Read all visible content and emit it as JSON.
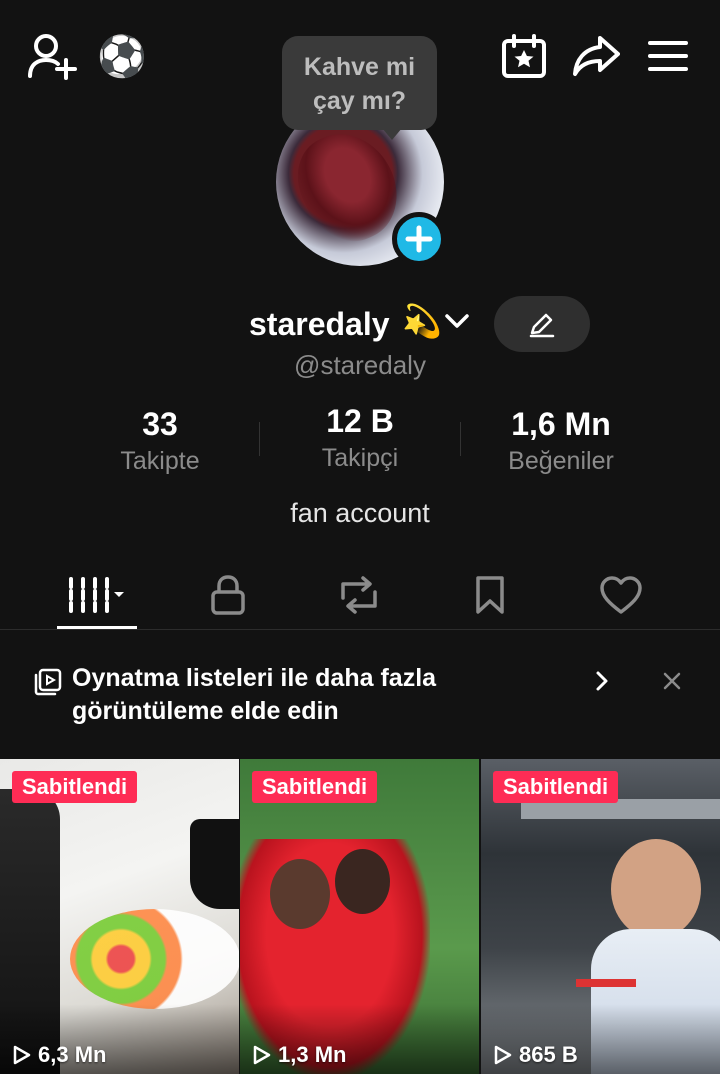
{
  "tooltip": {
    "line1": "Kahve mi",
    "line2": "çay mı?"
  },
  "profile": {
    "display_name": "staredaly",
    "name_emoji": "💫",
    "handle": "@staredaly",
    "bio": "fan account"
  },
  "stats": [
    {
      "value": "33",
      "label": "Takipte"
    },
    {
      "value": "12 B",
      "label": "Takipçi"
    },
    {
      "value": "1,6 Mn",
      "label": "Beğeniler"
    }
  ],
  "tabs": [
    {
      "icon": "videos-grid-icon",
      "active": true
    },
    {
      "icon": "lock-icon",
      "active": false
    },
    {
      "icon": "repost-icon",
      "active": false
    },
    {
      "icon": "bookmark-icon",
      "active": false
    },
    {
      "icon": "heart-icon",
      "active": false
    }
  ],
  "banner": {
    "text": "Oynatma listeleri ile daha fazla görüntüleme elde edin"
  },
  "videos": [
    {
      "badge": "Sabitlendi",
      "views": "6,3 Mn"
    },
    {
      "badge": "Sabitlendi",
      "views": "1,3 Mn"
    },
    {
      "badge": "Sabitlendi",
      "views": "865 B"
    }
  ],
  "colors": {
    "background": "#121212",
    "accent_badge": "#fe2c55",
    "add_badge": "#20b9e6"
  }
}
